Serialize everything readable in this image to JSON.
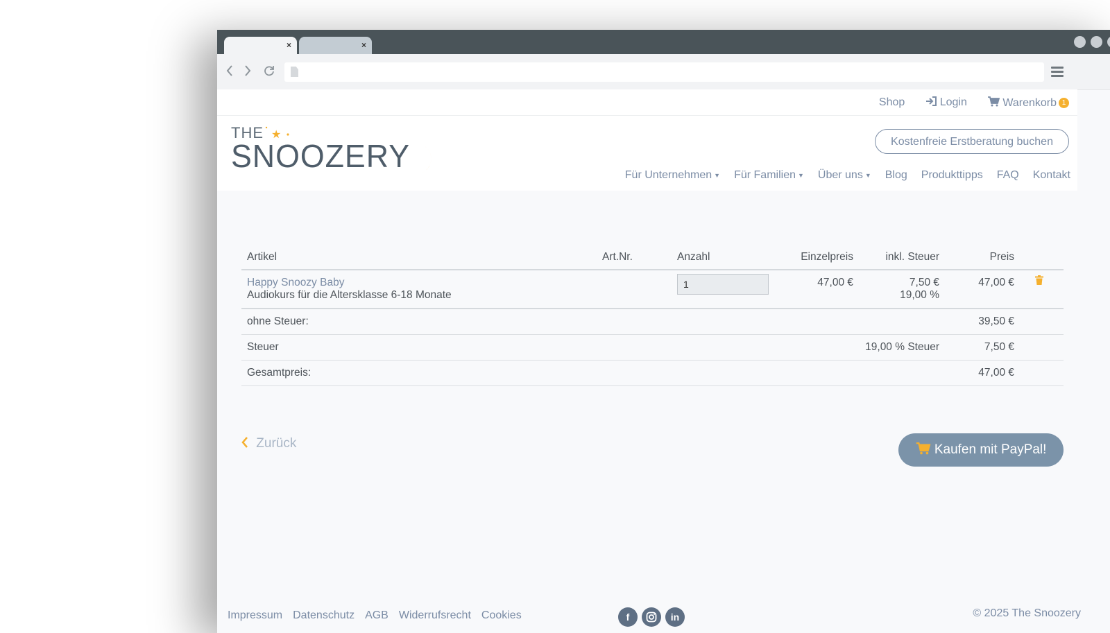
{
  "browser": {
    "tabs": [
      {
        "close": "×"
      },
      {
        "close": "×"
      }
    ]
  },
  "topbar": {
    "shop": "Shop",
    "login": "Login",
    "cart": "Warenkorb",
    "cart_count": "1"
  },
  "header": {
    "logo_the": "THE",
    "logo_name": "SNOOZERY",
    "cta": "Kostenfreie Erstberatung buchen",
    "nav": [
      {
        "label": "Für Unternehmen",
        "dropdown": true
      },
      {
        "label": "Für Familien",
        "dropdown": true
      },
      {
        "label": "Über uns",
        "dropdown": true
      },
      {
        "label": "Blog"
      },
      {
        "label": "Produkttipps"
      },
      {
        "label": "FAQ"
      },
      {
        "label": "Kontakt"
      }
    ]
  },
  "cart": {
    "headers": {
      "artikel": "Artikel",
      "artnr": "Art.Nr.",
      "anzahl": "Anzahl",
      "einzelpreis": "Einzelpreis",
      "steuer": "inkl. Steuer",
      "preis": "Preis"
    },
    "items": [
      {
        "name": "Happy Snoozy Baby",
        "description": "Audiokurs für die Altersklasse 6-18 Monate",
        "artnr": "",
        "quantity": "1",
        "unit_price": "47,00 €",
        "tax_amount": "7,50 €",
        "tax_rate": "19,00 %",
        "price": "47,00 €"
      }
    ],
    "summary": {
      "net_label": "ohne Steuer:",
      "net_value": "39,50 €",
      "tax_label": "Steuer",
      "tax_rate_label": "19,00 % Steuer",
      "tax_value": "7,50 €",
      "total_label": "Gesamtpreis:",
      "total_value": "47,00 €"
    },
    "back": "Zurück",
    "buy": "Kaufen mit PayPal!"
  },
  "footer": {
    "links": [
      "Impressum",
      "Datenschutz",
      "AGB",
      "Widerrufsrecht",
      "Cookies"
    ],
    "social": [
      "facebook",
      "instagram",
      "linkedin"
    ],
    "copyright": "© 2025 The Snoozery"
  },
  "colors": {
    "accent": "#f5b02e",
    "link": "#7b8ca5",
    "button": "#7b93a9",
    "titlebar": "#4a5459"
  }
}
